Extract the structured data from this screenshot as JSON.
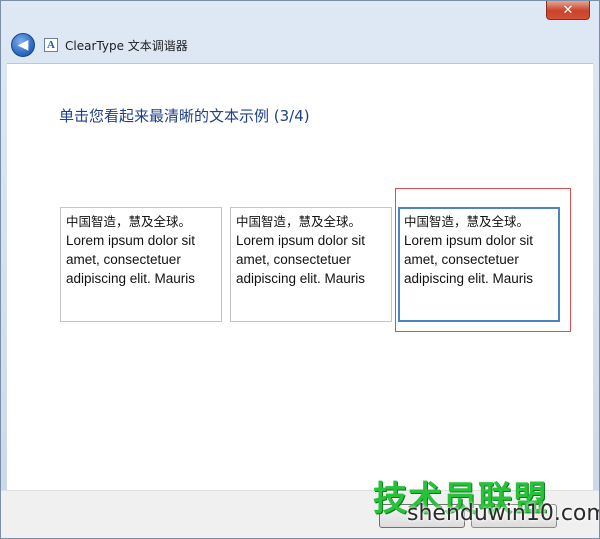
{
  "window": {
    "app_title": "ClearType 文本调谐器",
    "close_symbol": "✕",
    "back_icon": "back-arrow-icon",
    "app_icon_letter": "A"
  },
  "main": {
    "instruction": "单击您看起来最清晰的文本示例 (3/4)",
    "samples": [
      {
        "cjk": "中国智造，慧及全球。",
        "latin": "Lorem ipsum dolor sit amet, consectetuer adipiscing elit. Mauris"
      },
      {
        "cjk": "中国智造，慧及全球。",
        "latin": "Lorem ipsum dolor sit amet, consectetuer adipiscing elit. Mauris"
      },
      {
        "cjk": "中国智造，慧及全球。",
        "latin": "Lorem ipsum dolor sit amet, consectetuer adipiscing elit. Mauris"
      }
    ],
    "selected_index": 3
  },
  "watermark": {
    "cn": "技术员联盟",
    "en": "shenduwin10.com"
  }
}
